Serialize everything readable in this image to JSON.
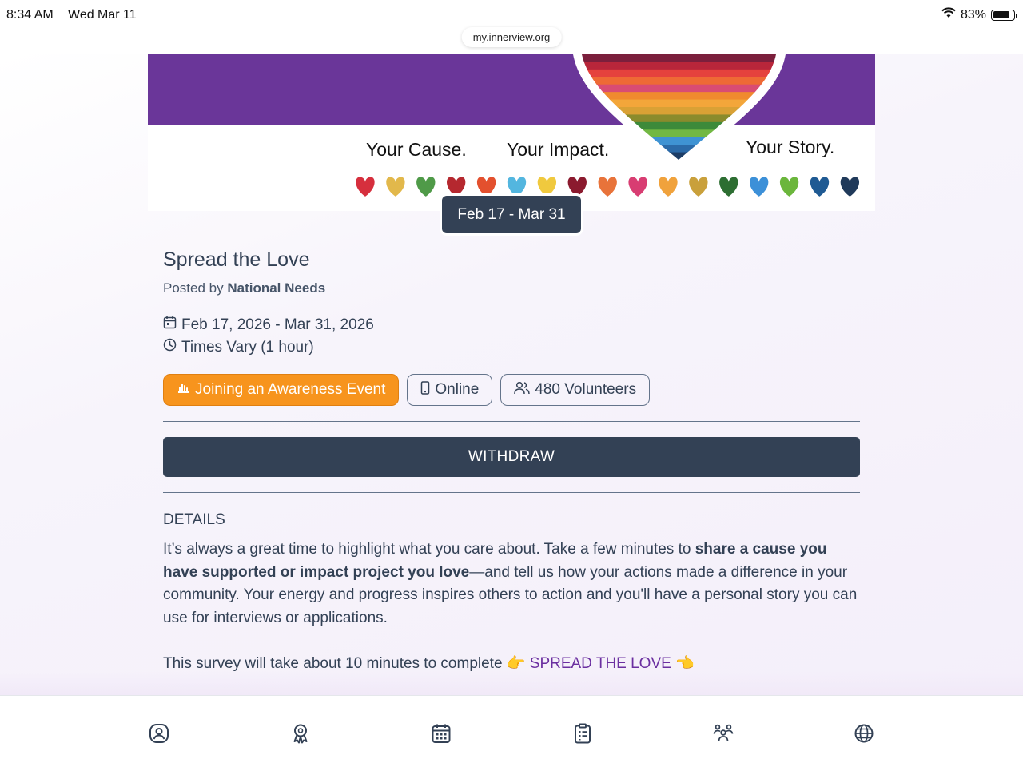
{
  "status_bar": {
    "time": "8:34 AM",
    "date": "Wed Mar 11",
    "battery": "83%",
    "battery_level": 0.83,
    "url": "my.innerview.org"
  },
  "banner": {
    "tagline_cause": "Your Cause.",
    "tagline_impact": "Your Impact.",
    "tagline_story": "Your Story.",
    "purple": "#6a3699",
    "heart_colors": [
      "#d62f3d",
      "#e2b84b",
      "#4f9a48",
      "#b5282f",
      "#e3502e",
      "#53b6df",
      "#f0c93e",
      "#8b1a2e",
      "#e8733a",
      "#d83d72",
      "#f0a23c",
      "#c9a03b",
      "#2d6e32",
      "#3c90d8",
      "#6bb63c",
      "#1f5a93",
      "#203a5a"
    ],
    "stripe_colors": [
      "#7b1f3c",
      "#b8263a",
      "#e5423d",
      "#ee6a35",
      "#d94c73",
      "#f08a2e",
      "#f3a63a",
      "#d9a135",
      "#8a8b2c",
      "#3d8a3a",
      "#72b843",
      "#3f93d3",
      "#2b6aa8",
      "#1d3d66"
    ]
  },
  "date_badge": "Feb 17 - Mar 31",
  "event": {
    "title": "Spread the Love",
    "posted_by_prefix": "Posted by",
    "posted_by": "National Needs",
    "date_range": "Feb 17, 2026 - Mar 31, 2026",
    "time": "Times Vary (1 hour)"
  },
  "chips": {
    "type": "Joining an Awareness Event",
    "mode": "Online",
    "volunteers": "480 Volunteers"
  },
  "withdraw_label": "WITHDRAW",
  "details": {
    "heading": "DETAILS",
    "p_before": "It’s always a great time to highlight what you care about. Take a few minutes to ",
    "p_bold": "share a cause you have supported or impact project you love",
    "p_after": "—and tell us how your actions made a difference in your community. Your energy and progress inspires others to action and you'll have a personal story you can use for interviews or applications.",
    "survey_text": "This survey will take about 10 minutes to complete",
    "survey_link": "SPREAD THE LOVE"
  },
  "tabbar": {
    "items": [
      "profile-icon",
      "award-icon",
      "calendar-icon",
      "clipboard-icon",
      "group-icon",
      "globe-icon"
    ]
  }
}
